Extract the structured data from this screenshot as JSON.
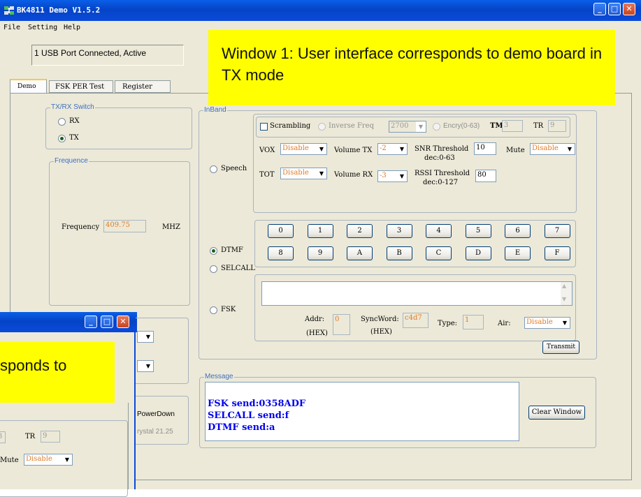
{
  "window": {
    "title": "BK4811 Demo V1.5.2",
    "menu": [
      "File",
      "Setting",
      "Help"
    ],
    "status": "1 USB Port Connected, Active",
    "tabs": [
      "Demo",
      "FSK PER Test",
      "Register"
    ]
  },
  "callouts": {
    "main": "Window 1: User interface corresponds to demo board in TX mode",
    "back_line1": "sponds to"
  },
  "txrx": {
    "title": "TX/RX Switch",
    "options": [
      "RX",
      "TX"
    ],
    "selected": "TX"
  },
  "frequence": {
    "title": "Frequence",
    "label": "Frequency",
    "value": "409.75",
    "unit": "MHZ"
  },
  "inband": {
    "title": "InBand",
    "modes": [
      "Speech",
      "DTMF",
      "SELCALL",
      "FSK"
    ],
    "selected_mode": "DTMF",
    "scrambling": {
      "label": "Scrambling",
      "inverse_label": "Inverse Freq",
      "inverse_value": "2700",
      "encry_label": "Encry(0-63)",
      "tm_label": "TM",
      "tm_value": "3",
      "tr_label": "TR",
      "tr_value": "9"
    },
    "vox": {
      "label": "VOX",
      "value": "Disable"
    },
    "volume_tx": {
      "label": "Volume TX",
      "value": "-2"
    },
    "snr": {
      "label": "SNR Threshold",
      "range": "dec:0-63",
      "value": "10"
    },
    "mute": {
      "label": "Mute",
      "value": "Disable"
    },
    "tot": {
      "label": "TOT",
      "value": "Disable"
    },
    "volume_rx": {
      "label": "Volume RX",
      "value": "-3"
    },
    "rssi": {
      "label": "RSSI Threshold",
      "range": "dec:0-127",
      "value": "80"
    },
    "dtmf_keys": [
      "0",
      "1",
      "2",
      "3",
      "4",
      "5",
      "6",
      "7",
      "8",
      "9",
      "A",
      "B",
      "C",
      "D",
      "E",
      "F"
    ],
    "fsk": {
      "addr_label": "Addr:",
      "hex": "(HEX)",
      "addr_value": "0",
      "sync_label": "SyncWord:",
      "sync_value": "c4d7",
      "type_label": "Type:",
      "type_value": "1",
      "air_label": "Air:",
      "air_value": "Disable"
    },
    "transmit_label": "Transmit"
  },
  "message": {
    "title": "Message",
    "lines": [
      "FSK send:0358ADF",
      "SELCALL send:f",
      "DTMF send:a"
    ],
    "clear_label": "Clear Window"
  },
  "back_window": {
    "powerdown": "PowerDown",
    "crystal": "rystal 21.25",
    "tr_label": "TR",
    "tr_value": "9",
    "tm_value": "3",
    "mute_label": "Mute",
    "mute_value": "Disable"
  },
  "colors": {
    "title_bar": "#0544c7",
    "callout": "#ffff00",
    "message_text": "#0000ee",
    "readonly_text": "#e07b27",
    "group_title": "#3d6fbf"
  }
}
